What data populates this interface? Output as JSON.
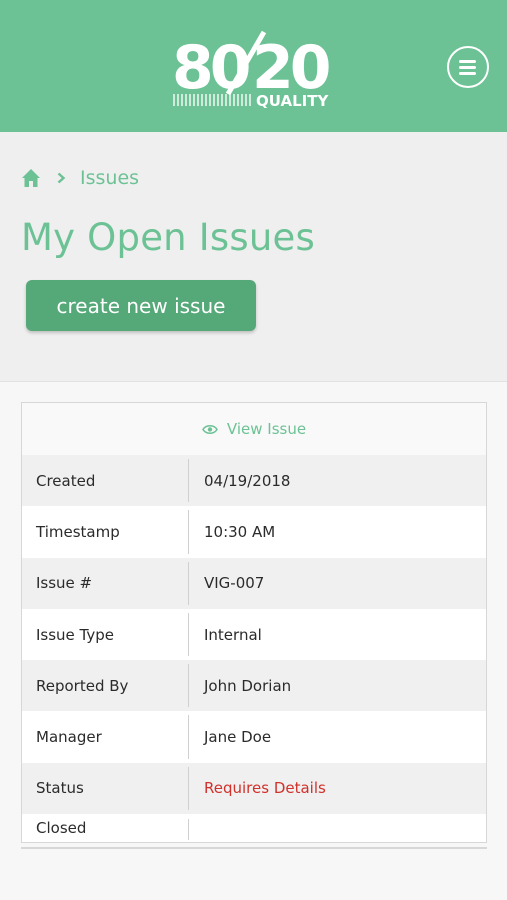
{
  "header": {
    "logo_text_left": "80",
    "logo_text_right": "20",
    "logo_subtext": "QUALITY",
    "brand_color": "#6cc295"
  },
  "breadcrumb": {
    "home_icon": "home-icon",
    "separator_icon": "chevron-right-icon",
    "current": "Issues"
  },
  "page": {
    "title": "My Open Issues",
    "create_button": "create new issue"
  },
  "issue_card": {
    "view_link": "View Issue",
    "view_icon": "eye-icon",
    "rows": [
      {
        "label": "Created",
        "value": "04/19/2018"
      },
      {
        "label": "Timestamp",
        "value": "10:30 AM"
      },
      {
        "label": "Issue #",
        "value": "VIG-007"
      },
      {
        "label": "Issue Type",
        "value": "Internal"
      },
      {
        "label": "Reported By",
        "value": "John Dorian"
      },
      {
        "label": "Manager",
        "value": "Jane Doe"
      },
      {
        "label": "Status",
        "value": "Requires Details"
      },
      {
        "label": "Closed",
        "value": ""
      }
    ],
    "status_color": "#d1312b"
  }
}
